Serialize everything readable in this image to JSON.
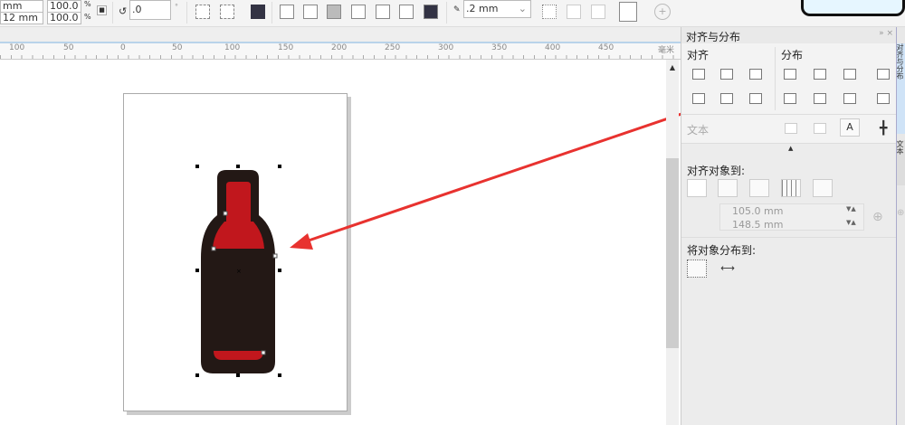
{
  "toolbar": {
    "width_value": "mm",
    "height_value": "12 mm",
    "scale_x": "100.0",
    "scale_y": "100.0",
    "percent": "%",
    "rotation": ".0",
    "degree": "°",
    "outline_width": ".2 mm"
  },
  "ruler": {
    "ticks": [
      "100",
      "50",
      "0",
      "50",
      "100",
      "150",
      "200",
      "250",
      "300",
      "350",
      "400",
      "450"
    ],
    "unit": "毫米"
  },
  "panel": {
    "title": "对齐与分布",
    "align_label": "对齐",
    "distribute_label": "分布",
    "text_label": "文本",
    "align_to_label": "对齐对象到:",
    "x_value": "105.0 mm",
    "y_value": "148.5 mm",
    "distribute_to_label": "将对象分布到:"
  },
  "side_tabs": [
    "对齐与分布",
    "文本"
  ],
  "colors": {
    "bottle": "#231815",
    "wine": "#c1171d",
    "arrow": "#e8322f"
  }
}
